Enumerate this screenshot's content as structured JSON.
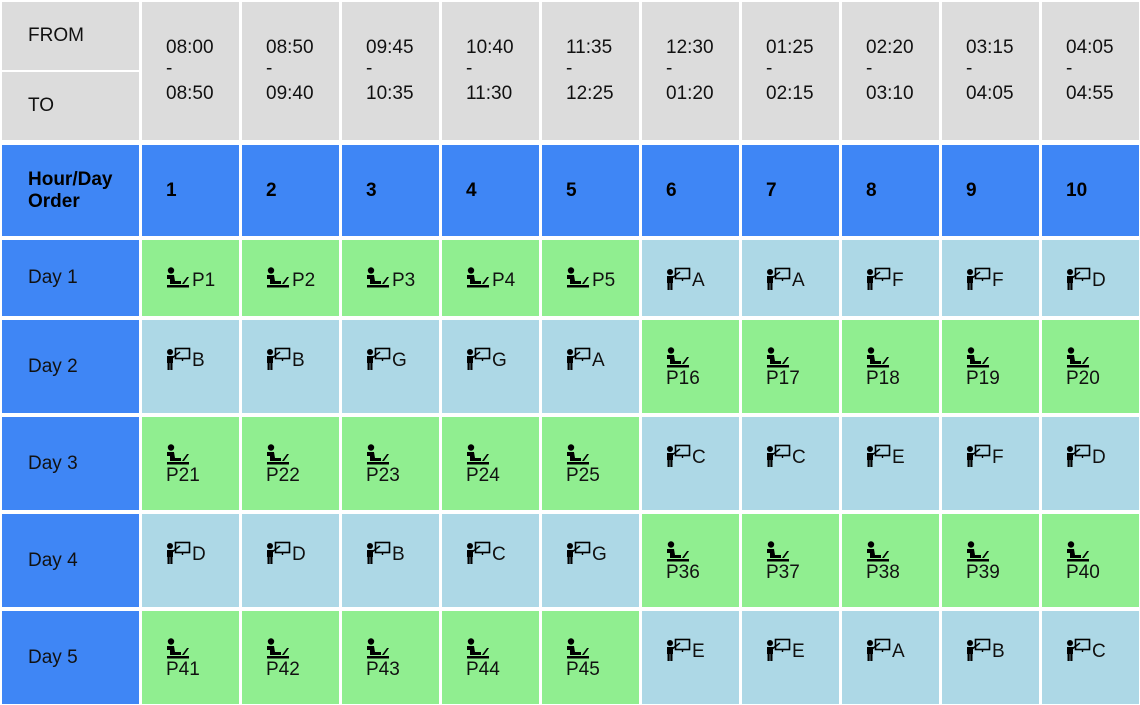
{
  "header": {
    "from_label": "FROM",
    "to_label": "TO",
    "hour_day_label": "Hour/Day Order",
    "periods": [
      {
        "num": "1",
        "from": "08:00",
        "to": "08:50"
      },
      {
        "num": "2",
        "from": "08:50",
        "to": "09:40"
      },
      {
        "num": "3",
        "from": "09:45",
        "to": "10:35"
      },
      {
        "num": "4",
        "from": "10:40",
        "to": "11:30"
      },
      {
        "num": "5",
        "from": "11:35",
        "to": "12:25"
      },
      {
        "num": "6",
        "from": "12:30",
        "to": "01:20"
      },
      {
        "num": "7",
        "from": "01:25",
        "to": "02:15"
      },
      {
        "num": "8",
        "from": "02:20",
        "to": "03:10"
      },
      {
        "num": "9",
        "from": "03:15",
        "to": "04:05"
      },
      {
        "num": "10",
        "from": "04:05",
        "to": "04:55"
      }
    ],
    "dash": "-"
  },
  "colors": {
    "header_gray": "#dcdcdc",
    "header_blue": "#3f86f5",
    "practical_green": "#90ee90",
    "theory_lightblue": "#add8e6"
  },
  "days": [
    {
      "label": "Day 1",
      "slots": [
        {
          "type": "practical",
          "code": "P1",
          "layout": "inline"
        },
        {
          "type": "practical",
          "code": "P2",
          "layout": "inline"
        },
        {
          "type": "practical",
          "code": "P3",
          "layout": "inline"
        },
        {
          "type": "practical",
          "code": "P4",
          "layout": "inline"
        },
        {
          "type": "practical",
          "code": "P5",
          "layout": "inline"
        },
        {
          "type": "theory",
          "code": "A"
        },
        {
          "type": "theory",
          "code": "A"
        },
        {
          "type": "theory",
          "code": "F"
        },
        {
          "type": "theory",
          "code": "F"
        },
        {
          "type": "theory",
          "code": "D"
        }
      ]
    },
    {
      "label": "Day 2",
      "slots": [
        {
          "type": "theory",
          "code": "B"
        },
        {
          "type": "theory",
          "code": "B"
        },
        {
          "type": "theory",
          "code": "G"
        },
        {
          "type": "theory",
          "code": "G"
        },
        {
          "type": "theory",
          "code": "A"
        },
        {
          "type": "practical",
          "code": "P16",
          "layout": "stack"
        },
        {
          "type": "practical",
          "code": "P17",
          "layout": "stack"
        },
        {
          "type": "practical",
          "code": "P18",
          "layout": "stack"
        },
        {
          "type": "practical",
          "code": "P19",
          "layout": "stack"
        },
        {
          "type": "practical",
          "code": "P20",
          "layout": "stack"
        }
      ]
    },
    {
      "label": "Day 3",
      "slots": [
        {
          "type": "practical",
          "code": "P21",
          "layout": "stack"
        },
        {
          "type": "practical",
          "code": "P22",
          "layout": "stack"
        },
        {
          "type": "practical",
          "code": "P23",
          "layout": "stack"
        },
        {
          "type": "practical",
          "code": "P24",
          "layout": "stack"
        },
        {
          "type": "practical",
          "code": "P25",
          "layout": "stack"
        },
        {
          "type": "theory",
          "code": "C"
        },
        {
          "type": "theory",
          "code": "C"
        },
        {
          "type": "theory",
          "code": "E"
        },
        {
          "type": "theory",
          "code": "F"
        },
        {
          "type": "theory",
          "code": "D"
        }
      ]
    },
    {
      "label": "Day 4",
      "slots": [
        {
          "type": "theory",
          "code": "D"
        },
        {
          "type": "theory",
          "code": "D"
        },
        {
          "type": "theory",
          "code": "B"
        },
        {
          "type": "theory",
          "code": "C"
        },
        {
          "type": "theory",
          "code": "G"
        },
        {
          "type": "practical",
          "code": "P36",
          "layout": "stack"
        },
        {
          "type": "practical",
          "code": "P37",
          "layout": "stack"
        },
        {
          "type": "practical",
          "code": "P38",
          "layout": "stack"
        },
        {
          "type": "practical",
          "code": "P39",
          "layout": "stack"
        },
        {
          "type": "practical",
          "code": "P40",
          "layout": "stack"
        }
      ]
    },
    {
      "label": "Day 5",
      "slots": [
        {
          "type": "practical",
          "code": "P41",
          "layout": "stack"
        },
        {
          "type": "practical",
          "code": "P42",
          "layout": "stack"
        },
        {
          "type": "practical",
          "code": "P43",
          "layout": "stack"
        },
        {
          "type": "practical",
          "code": "P44",
          "layout": "stack"
        },
        {
          "type": "practical",
          "code": "P45",
          "layout": "stack"
        },
        {
          "type": "theory",
          "code": "E"
        },
        {
          "type": "theory",
          "code": "E"
        },
        {
          "type": "theory",
          "code": "A"
        },
        {
          "type": "theory",
          "code": "B"
        },
        {
          "type": "theory",
          "code": "C"
        }
      ]
    }
  ]
}
